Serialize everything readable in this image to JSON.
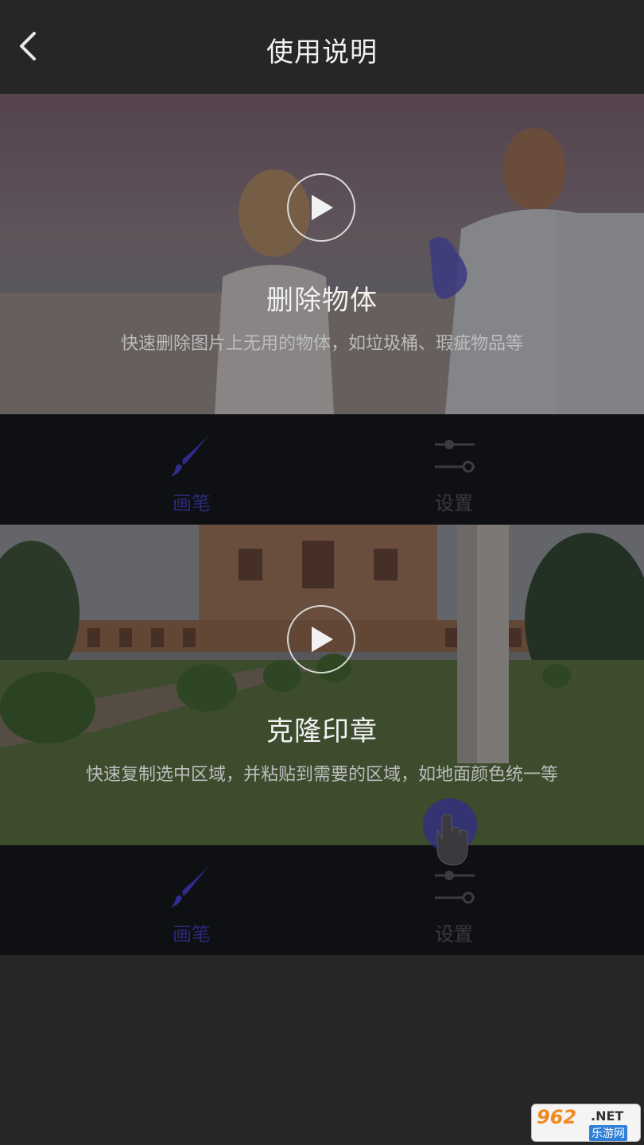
{
  "header": {
    "title": "使用说明",
    "back_icon": "chevron-left-icon"
  },
  "cards": [
    {
      "title": "删除物体",
      "description": "快速删除图片上无用的物体，如垃圾桶、瑕疵物品等",
      "tools": [
        {
          "label": "画笔",
          "icon": "brush-icon"
        },
        {
          "label": "设置",
          "icon": "sliders-icon"
        }
      ]
    },
    {
      "title": "克隆印章",
      "description": "快速复制选中区域，并粘贴到需要的区域，如地面颜色统一等",
      "tools": [
        {
          "label": "画笔",
          "icon": "brush-icon"
        },
        {
          "label": "设置",
          "icon": "sliders-icon"
        }
      ]
    }
  ],
  "watermark": {
    "top": "962",
    "net": ".NET",
    "bottom": "乐游网"
  },
  "colors": {
    "background": "#262626",
    "toolbar": "#0f1014",
    "accent": "#3a36a8"
  }
}
